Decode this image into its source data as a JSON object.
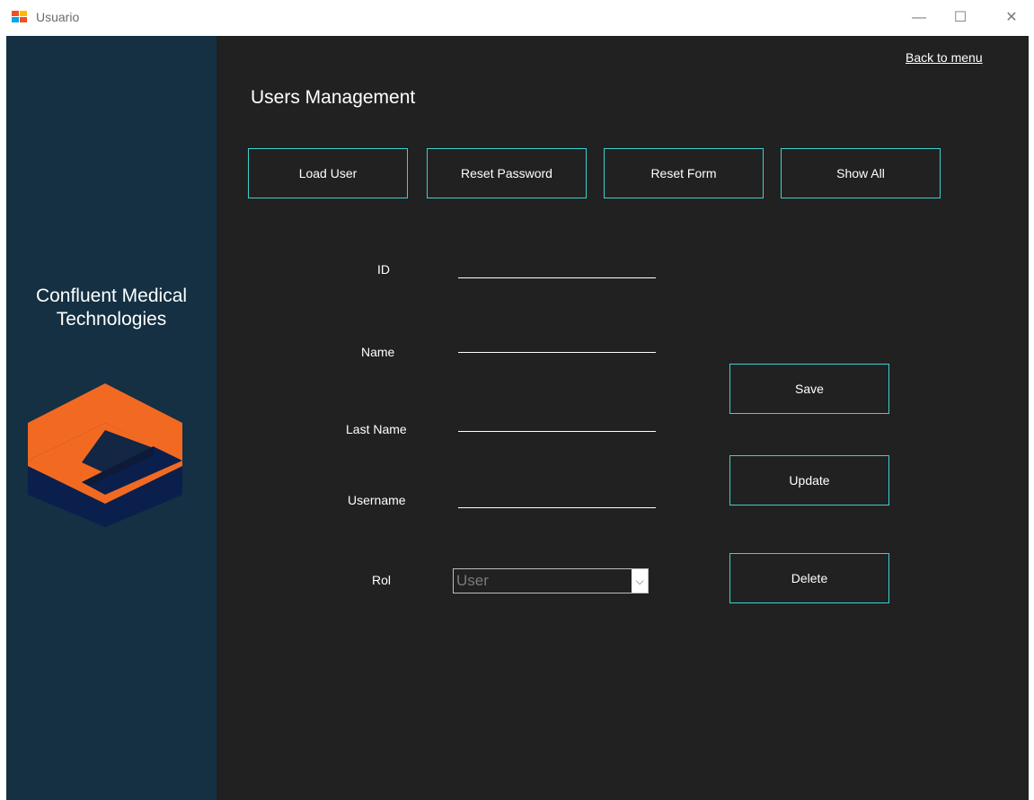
{
  "window": {
    "title": "Usuario",
    "minimize": "—",
    "maximize": "☐",
    "close": "✕"
  },
  "sidebar": {
    "company_line1": "Confluent Medical",
    "company_line2": "Technologies",
    "logo_colors": {
      "orange": "#f26a22",
      "navy": "#0b1f4d",
      "dark": "#132644"
    }
  },
  "header": {
    "back_link": "Back to menu",
    "title": "Users Management"
  },
  "toolbar": {
    "load_user": "Load User",
    "reset_password": "Reset Password",
    "reset_form": "Reset Form",
    "show_all": "Show All"
  },
  "form": {
    "id_label": "ID",
    "id_value": "",
    "name_label": "Name",
    "name_value": "",
    "last_name_label": "Last Name",
    "last_name_value": "",
    "username_label": "Username",
    "username_value": "",
    "rol_label": "Rol",
    "rol_value": "User"
  },
  "actions": {
    "save": "Save",
    "update": "Update",
    "delete": "Delete"
  },
  "colors": {
    "accent": "#3cd1cf",
    "sidebar_bg": "#143042",
    "main_bg": "#212121"
  }
}
